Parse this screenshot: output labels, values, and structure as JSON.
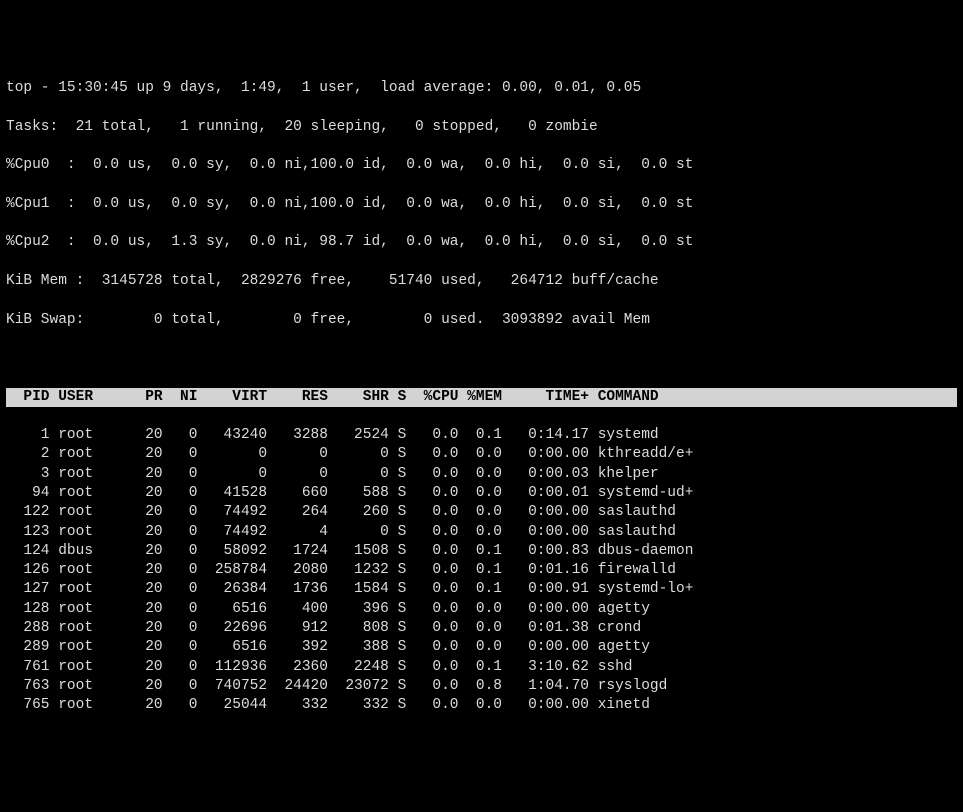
{
  "summary": {
    "line1": "top - 15:30:45 up 9 days,  1:49,  1 user,  load average: 0.00, 0.01, 0.05",
    "tasks": "Tasks:  21 total,   1 running,  20 sleeping,   0 stopped,   0 zombie",
    "cpu0": "%Cpu0  :  0.0 us,  0.0 sy,  0.0 ni,100.0 id,  0.0 wa,  0.0 hi,  0.0 si,  0.0 st",
    "cpu1": "%Cpu1  :  0.0 us,  0.0 sy,  0.0 ni,100.0 id,  0.0 wa,  0.0 hi,  0.0 si,  0.0 st",
    "cpu2": "%Cpu2  :  0.0 us,  1.3 sy,  0.0 ni, 98.7 id,  0.0 wa,  0.0 hi,  0.0 si,  0.0 st",
    "mem": "KiB Mem :  3145728 total,  2829276 free,    51740 used,   264712 buff/cache",
    "swap": "KiB Swap:        0 total,        0 free,        0 used.  3093892 avail Mem "
  },
  "columns": [
    "PID",
    "USER",
    "PR",
    "NI",
    "VIRT",
    "RES",
    "SHR",
    "S",
    "%CPU",
    "%MEM",
    "TIME+",
    "COMMAND"
  ],
  "processes": [
    {
      "pid": 1,
      "user": "root",
      "pr": 20,
      "ni": 0,
      "virt": 43240,
      "res": 3288,
      "shr": 2524,
      "s": "S",
      "cpu": 0.0,
      "mem": 0.1,
      "time": "0:14.17",
      "cmd": "systemd"
    },
    {
      "pid": 2,
      "user": "root",
      "pr": 20,
      "ni": 0,
      "virt": 0,
      "res": 0,
      "shr": 0,
      "s": "S",
      "cpu": 0.0,
      "mem": 0.0,
      "time": "0:00.00",
      "cmd": "kthreadd/e+"
    },
    {
      "pid": 3,
      "user": "root",
      "pr": 20,
      "ni": 0,
      "virt": 0,
      "res": 0,
      "shr": 0,
      "s": "S",
      "cpu": 0.0,
      "mem": 0.0,
      "time": "0:00.03",
      "cmd": "khelper"
    },
    {
      "pid": 94,
      "user": "root",
      "pr": 20,
      "ni": 0,
      "virt": 41528,
      "res": 660,
      "shr": 588,
      "s": "S",
      "cpu": 0.0,
      "mem": 0.0,
      "time": "0:00.01",
      "cmd": "systemd-ud+"
    },
    {
      "pid": 122,
      "user": "root",
      "pr": 20,
      "ni": 0,
      "virt": 74492,
      "res": 264,
      "shr": 260,
      "s": "S",
      "cpu": 0.0,
      "mem": 0.0,
      "time": "0:00.00",
      "cmd": "saslauthd"
    },
    {
      "pid": 123,
      "user": "root",
      "pr": 20,
      "ni": 0,
      "virt": 74492,
      "res": 4,
      "shr": 0,
      "s": "S",
      "cpu": 0.0,
      "mem": 0.0,
      "time": "0:00.00",
      "cmd": "saslauthd"
    },
    {
      "pid": 124,
      "user": "dbus",
      "pr": 20,
      "ni": 0,
      "virt": 58092,
      "res": 1724,
      "shr": 1508,
      "s": "S",
      "cpu": 0.0,
      "mem": 0.1,
      "time": "0:00.83",
      "cmd": "dbus-daemon"
    },
    {
      "pid": 126,
      "user": "root",
      "pr": 20,
      "ni": 0,
      "virt": 258784,
      "res": 2080,
      "shr": 1232,
      "s": "S",
      "cpu": 0.0,
      "mem": 0.1,
      "time": "0:01.16",
      "cmd": "firewalld"
    },
    {
      "pid": 127,
      "user": "root",
      "pr": 20,
      "ni": 0,
      "virt": 26384,
      "res": 1736,
      "shr": 1584,
      "s": "S",
      "cpu": 0.0,
      "mem": 0.1,
      "time": "0:00.91",
      "cmd": "systemd-lo+"
    },
    {
      "pid": 128,
      "user": "root",
      "pr": 20,
      "ni": 0,
      "virt": 6516,
      "res": 400,
      "shr": 396,
      "s": "S",
      "cpu": 0.0,
      "mem": 0.0,
      "time": "0:00.00",
      "cmd": "agetty"
    },
    {
      "pid": 288,
      "user": "root",
      "pr": 20,
      "ni": 0,
      "virt": 22696,
      "res": 912,
      "shr": 808,
      "s": "S",
      "cpu": 0.0,
      "mem": 0.0,
      "time": "0:01.38",
      "cmd": "crond"
    },
    {
      "pid": 289,
      "user": "root",
      "pr": 20,
      "ni": 0,
      "virt": 6516,
      "res": 392,
      "shr": 388,
      "s": "S",
      "cpu": 0.0,
      "mem": 0.0,
      "time": "0:00.00",
      "cmd": "agetty"
    },
    {
      "pid": 761,
      "user": "root",
      "pr": 20,
      "ni": 0,
      "virt": 112936,
      "res": 2360,
      "shr": 2248,
      "s": "S",
      "cpu": 0.0,
      "mem": 0.1,
      "time": "3:10.62",
      "cmd": "sshd"
    },
    {
      "pid": 763,
      "user": "root",
      "pr": 20,
      "ni": 0,
      "virt": 740752,
      "res": 24420,
      "shr": 23072,
      "s": "S",
      "cpu": 0.0,
      "mem": 0.8,
      "time": "1:04.70",
      "cmd": "rsyslogd"
    },
    {
      "pid": 765,
      "user": "root",
      "pr": 20,
      "ni": 0,
      "virt": 25044,
      "res": 332,
      "shr": 332,
      "s": "S",
      "cpu": 0.0,
      "mem": 0.0,
      "time": "0:00.00",
      "cmd": "xinetd"
    }
  ]
}
